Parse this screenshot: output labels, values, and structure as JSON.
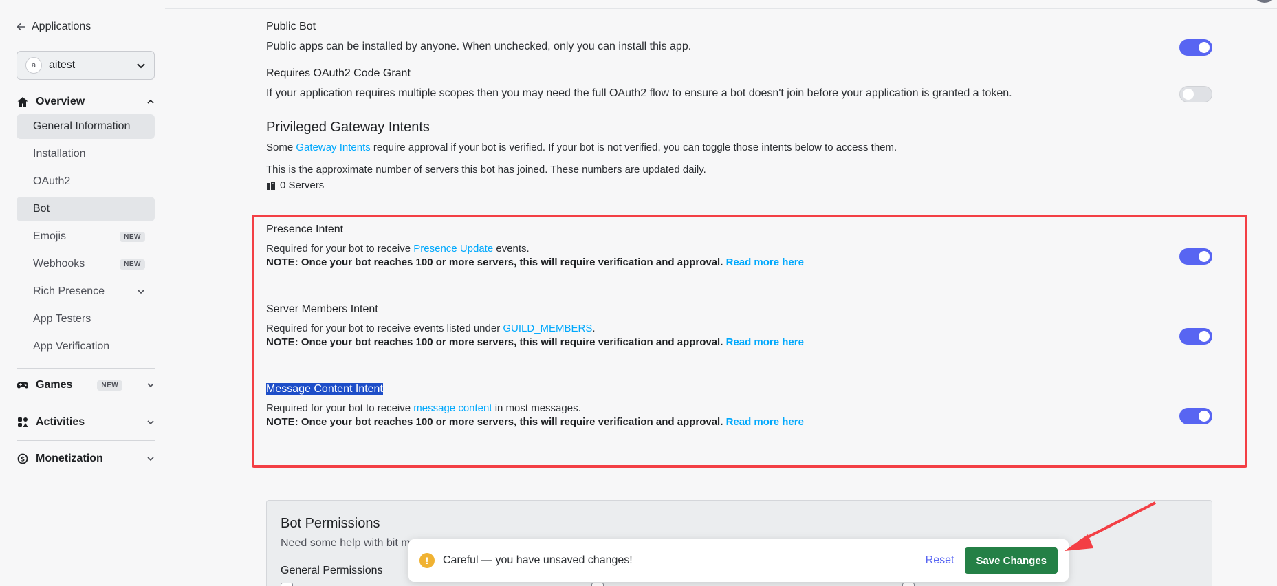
{
  "sidebar": {
    "back_label": "Applications",
    "app": {
      "avatar_letter": "a",
      "name": "aitest"
    },
    "overview": {
      "label": "Overview",
      "items": [
        {
          "label": "General Information"
        },
        {
          "label": "Installation"
        },
        {
          "label": "OAuth2"
        },
        {
          "label": "Bot"
        },
        {
          "label": "Emojis",
          "badge": "NEW"
        },
        {
          "label": "Webhooks",
          "badge": "NEW"
        },
        {
          "label": "Rich Presence"
        },
        {
          "label": "App Testers"
        },
        {
          "label": "App Verification"
        }
      ]
    },
    "games": {
      "label": "Games",
      "badge": "NEW"
    },
    "activities": {
      "label": "Activities"
    },
    "monetization": {
      "label": "Monetization"
    }
  },
  "main": {
    "public_bot": {
      "title": "Public Bot",
      "desc": "Public apps can be installed by anyone. When unchecked, only you can install this app.",
      "enabled": true
    },
    "oauth_grant": {
      "title": "Requires OAuth2 Code Grant",
      "desc": "If your application requires multiple scopes then you may need the full OAuth2 flow to ensure a bot doesn't join before your application is granted a token.",
      "enabled": false
    },
    "privileged": {
      "heading": "Privileged Gateway Intents",
      "desc_pre": "Some ",
      "desc_link": "Gateway Intents",
      "desc_post": " require approval if your bot is verified. If your bot is not verified, you can toggle those intents below to access them.",
      "servers_note": "This is the approximate number of servers this bot has joined. These numbers are updated daily.",
      "servers_count": "0 Servers"
    },
    "intents": [
      {
        "title": "Presence Intent",
        "desc_pre": "Required for your bot to receive ",
        "desc_link": "Presence Update",
        "desc_post": " events.",
        "enabled": true
      },
      {
        "title": "Server Members Intent",
        "desc_pre": "Required for your bot to receive events listed under ",
        "desc_link": "GUILD_MEMBERS",
        "desc_post": ".",
        "enabled": true
      },
      {
        "title": "Message Content Intent",
        "desc_pre": "Required for your bot to receive ",
        "desc_link": "message content",
        "desc_post": " in most messages.",
        "enabled": true
      }
    ],
    "note_text": "NOTE: Once your bot reaches 100 or more servers, this will require verification and approval. ",
    "read_more": "Read more here",
    "permissions": {
      "heading": "Bot Permissions",
      "sub": "Need some help with bit mat",
      "general": "General Permissions"
    }
  },
  "unsaved": {
    "message": "Careful — you have unsaved changes!",
    "reset": "Reset",
    "save": "Save Changes"
  },
  "colors": {
    "accent": "#5865f2",
    "link": "#00a8fc",
    "save": "#248046",
    "highlight_box": "#f33f45",
    "warning": "#f0b232"
  }
}
